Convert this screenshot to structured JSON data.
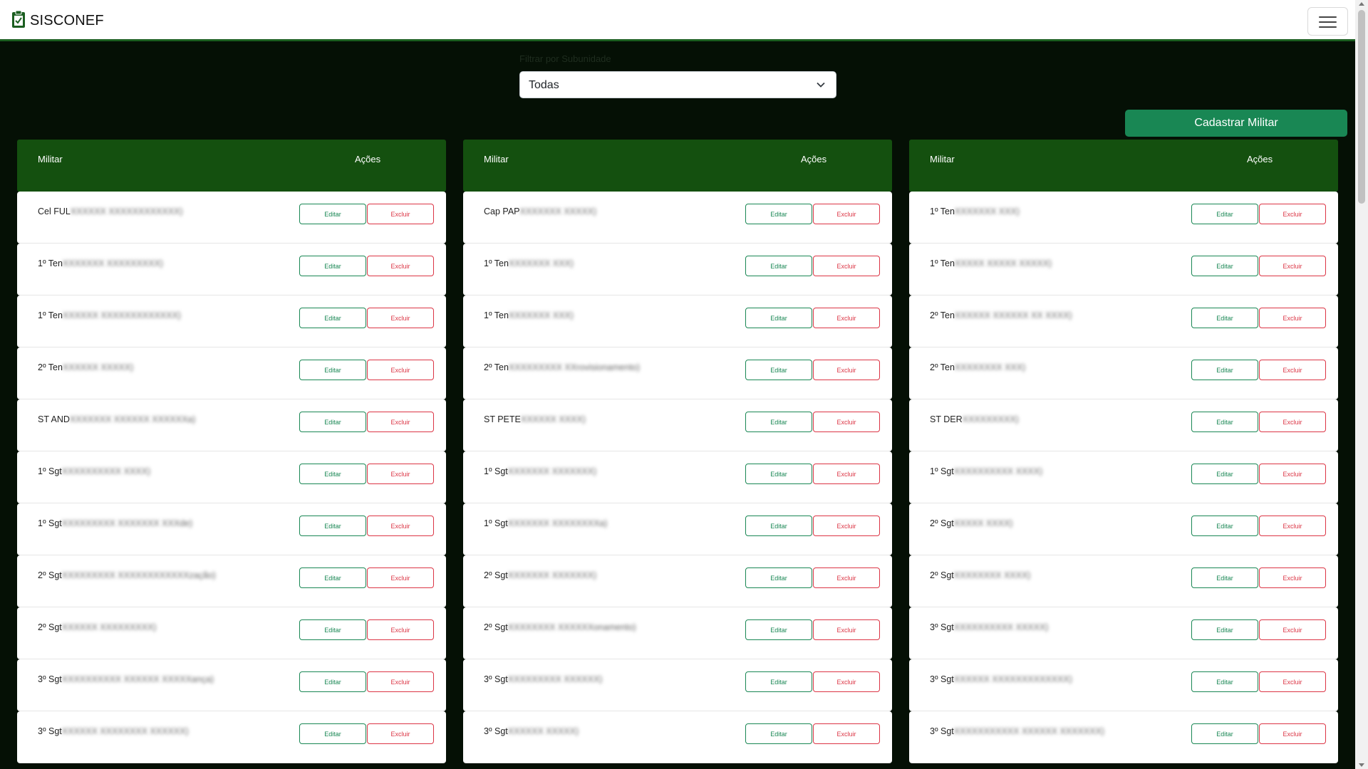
{
  "app": {
    "title": "SISCONEF",
    "icon": "clipboard-check-icon"
  },
  "navbar": {
    "menu_icon": "hamburger-icon"
  },
  "filter": {
    "label": "Filtrar por Subunidade",
    "value": "Todas"
  },
  "actions": {
    "cadastrar": "Cadastrar Militar"
  },
  "table": {
    "header_militar": "Militar",
    "header_acoes": "Ações",
    "edit_label": "Editar",
    "delete_label": "Excluir"
  },
  "columns": [
    [
      {
        "name": "Cel FUL",
        "hidden": "XXXXXX XXXXXXXXXXXX)"
      },
      {
        "name": "1º Ten",
        "hidden": "XXXXXXX XXXXXXXXX)"
      },
      {
        "name": "1º Ten",
        "hidden": "XXXXXX XXXXXXXXXXXXX)"
      },
      {
        "name": "2º Ten",
        "hidden": "XXXXXX XXXXX)"
      },
      {
        "name": "ST AND",
        "hidden": "XXXXXXX XXXXXX XXXXXXa)"
      },
      {
        "name": "1º Sgt",
        "hidden": "XXXXXXXXXX XXXX)"
      },
      {
        "name": "1º Sgt",
        "hidden": "XXXXXXXXX XXXXXXX XXXde)"
      },
      {
        "name": "2º Sgt",
        "hidden": "XXXXXXXXX XXXXXXXXXXXXzação)"
      },
      {
        "name": "2º Sgt",
        "hidden": "XXXXXX XXXXXXXXX)"
      },
      {
        "name": "3º Sgt",
        "hidden": "XXXXXXXXXX XXXXXX XXXXXança)"
      },
      {
        "name": "3º Sgt",
        "hidden": "XXXXXX XXXXXXXX XXXXXX)"
      }
    ],
    [
      {
        "name": "Cap PAP",
        "hidden": "XXXXXXX XXXXX)"
      },
      {
        "name": "1º Ten",
        "hidden": "XXXXXXX XXX)"
      },
      {
        "name": "1º Ten",
        "hidden": "XXXXXXX XXX)"
      },
      {
        "name": "2º Ten",
        "hidden": "XXXXXXXXX XXrovisionamento)"
      },
      {
        "name": "ST PETE",
        "hidden": "XXXXXX XXXX)"
      },
      {
        "name": "1º Sgt",
        "hidden": "XXXXXXX XXXXXXX)"
      },
      {
        "name": "1º Sgt",
        "hidden": "XXXXXXX XXXXXXXXa)"
      },
      {
        "name": "2º Sgt",
        "hidden": "XXXXXXX XXXXXXX)"
      },
      {
        "name": "2º Sgt",
        "hidden": "XXXXXXXX XXXXXXonamento)"
      },
      {
        "name": "3º Sgt",
        "hidden": "XXXXXXXXX XXXXXX)"
      },
      {
        "name": "3º Sgt",
        "hidden": "XXXXXX XXXXX)"
      }
    ],
    [
      {
        "name": "1º Ten",
        "hidden": "XXXXXXX XXX)"
      },
      {
        "name": "1º Ten",
        "hidden": "XXXXX XXXXX XXXXX)"
      },
      {
        "name": "2º Ten",
        "hidden": "XXXXXX XXXXXX XX XXXX)"
      },
      {
        "name": "2º Ten",
        "hidden": "XXXXXXXX XXX)"
      },
      {
        "name": "ST DER",
        "hidden": "XXXXXXXXX)"
      },
      {
        "name": "1º Sgt",
        "hidden": "XXXXXXXXXX XXXX)"
      },
      {
        "name": "2º Sgt",
        "hidden": "XXXXX XXXX)"
      },
      {
        "name": "2º Sgt",
        "hidden": "XXXXXXXX XXXX)"
      },
      {
        "name": "3º Sgt",
        "hidden": "XXXXXXXXXX XXXXX)"
      },
      {
        "name": "3º Sgt",
        "hidden": "XXXXXX XXXXXXXXXXXXX)"
      },
      {
        "name": "3º Sgt",
        "hidden": "XXXXXXXXXXX XXXXXX XXXXXXX)"
      }
    ]
  ]
}
